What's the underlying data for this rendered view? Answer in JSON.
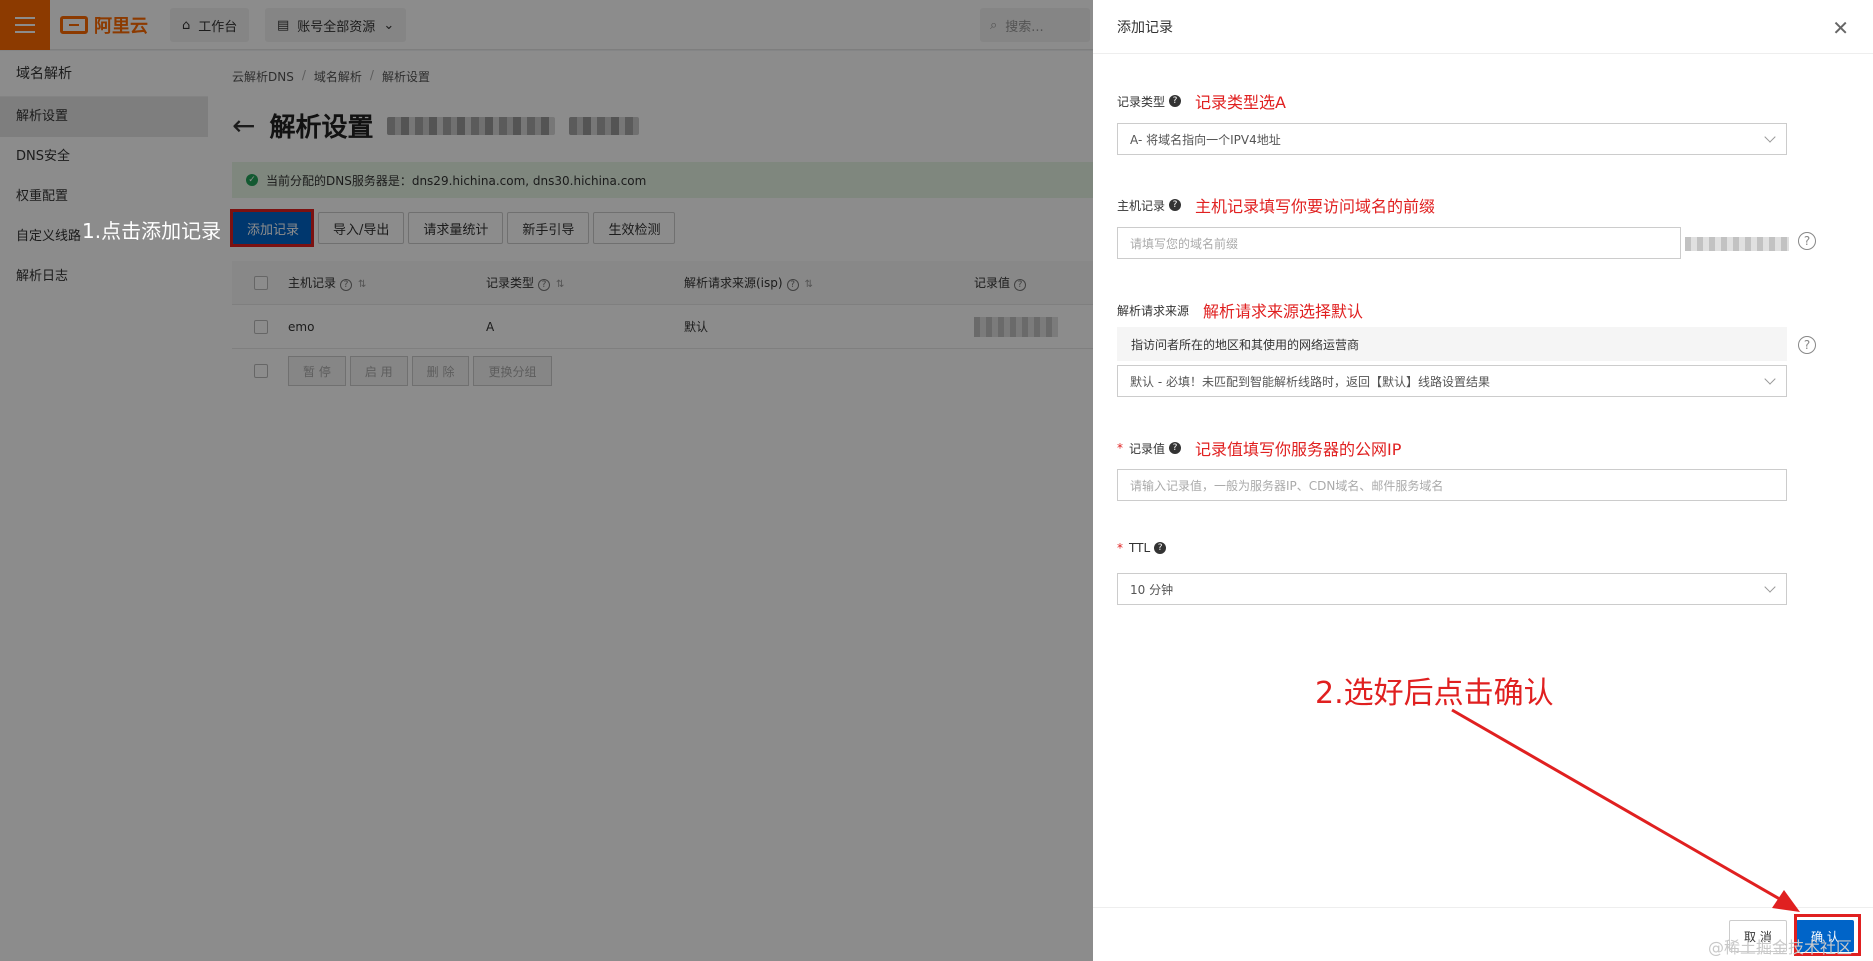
{
  "topbar": {
    "logo_text": "阿里云",
    "workbench": "工作台",
    "resources": "账号全部资源",
    "search_placeholder": "搜索..."
  },
  "sidebar": {
    "title": "域名解析",
    "items": [
      {
        "label": "解析设置",
        "active": true
      },
      {
        "label": "DNS安全"
      },
      {
        "label": "权重配置"
      },
      {
        "label": "自定义线路"
      },
      {
        "label": "解析日志"
      }
    ]
  },
  "breadcrumb": [
    "云解析DNS",
    "域名解析",
    "解析设置"
  ],
  "page": {
    "title": "解析设置",
    "dns_notice": "当前分配的DNS服务器是：dns29.hichina.com, dns30.hichina.com"
  },
  "toolbar": {
    "add_record": "添加记录",
    "import_export": "导入/导出",
    "request_stats": "请求量统计",
    "beginner_guide": "新手引导",
    "effect_check": "生效检测"
  },
  "table": {
    "headers": {
      "host": "主机记录",
      "type": "记录类型",
      "isp": "解析请求来源(isp)",
      "value": "记录值"
    },
    "rows": [
      {
        "host": "emo",
        "type": "A",
        "isp": "默认"
      }
    ],
    "bulk": [
      "暂 停",
      "启 用",
      "删 除",
      "更换分组"
    ]
  },
  "annotations": {
    "step1": "1.点击添加记录",
    "step2": "2.选好后点击确认",
    "type_hint": "记录类型选A",
    "host_hint": "主机记录填写你要访问域名的前缀",
    "isp_hint": "解析请求来源选择默认",
    "value_hint": "记录值填写你服务器的公网IP"
  },
  "drawer": {
    "title": "添加记录",
    "record_type_label": "记录类型",
    "record_type_value": "A- 将域名指向一个IPV4地址",
    "host_label": "主机记录",
    "host_placeholder": "请填写您的域名前缀",
    "isp_label": "解析请求来源",
    "isp_desc": "指访问者所在的地区和其使用的网络运营商",
    "isp_value": "默认 - 必填！未匹配到智能解析线路时，返回【默认】线路设置结果",
    "value_label": "记录值",
    "value_placeholder": "请输入记录值，一般为服务器IP、CDN域名、邮件服务域名",
    "ttl_label": "TTL",
    "ttl_value": "10 分钟",
    "cancel": "取 消",
    "confirm": "确 认"
  },
  "watermark": "@稀土掘金技术社区",
  "colors": {
    "brand": "#ff6a00",
    "primary": "#0064c8",
    "annotation": "#e02020"
  }
}
